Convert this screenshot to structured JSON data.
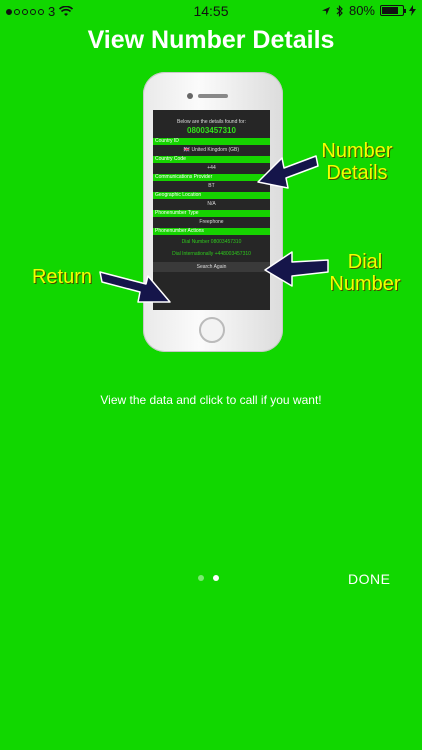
{
  "status_bar": {
    "carrier": "3",
    "time": "14:55",
    "battery_percent": "80%"
  },
  "page_title": "View Number Details",
  "app_screen": {
    "header": "Below are the details found for:",
    "number": "08003457310",
    "rows": [
      {
        "label": "Country ID",
        "value": "🇬🇧 United Kingdom (GB)"
      },
      {
        "label": "Country Code",
        "value": "+44"
      },
      {
        "label": "Communications Provider",
        "value": "BT"
      },
      {
        "label": "Geographic Location",
        "value": "N/A"
      },
      {
        "label": "Phonenumber Type",
        "value": "Freephone"
      }
    ],
    "actions_label": "Phonenumber Actions",
    "dial_number": "Dial Number 08003457310",
    "dial_international": "Dial Internationally +448003457310",
    "search_again": "Search Again"
  },
  "annotations": {
    "number_details_line1": "Number",
    "number_details_line2": "Details",
    "dial_number_line1": "Dial",
    "dial_number_line2": "Number",
    "return": "Return"
  },
  "caption": "View the data and click to call if you want!",
  "pager": {
    "count": 2,
    "active_index": 1
  },
  "done_label": "DONE",
  "colors": {
    "background": "#11d700",
    "annotation": "#f4ff00",
    "arrow": "#15154a"
  }
}
